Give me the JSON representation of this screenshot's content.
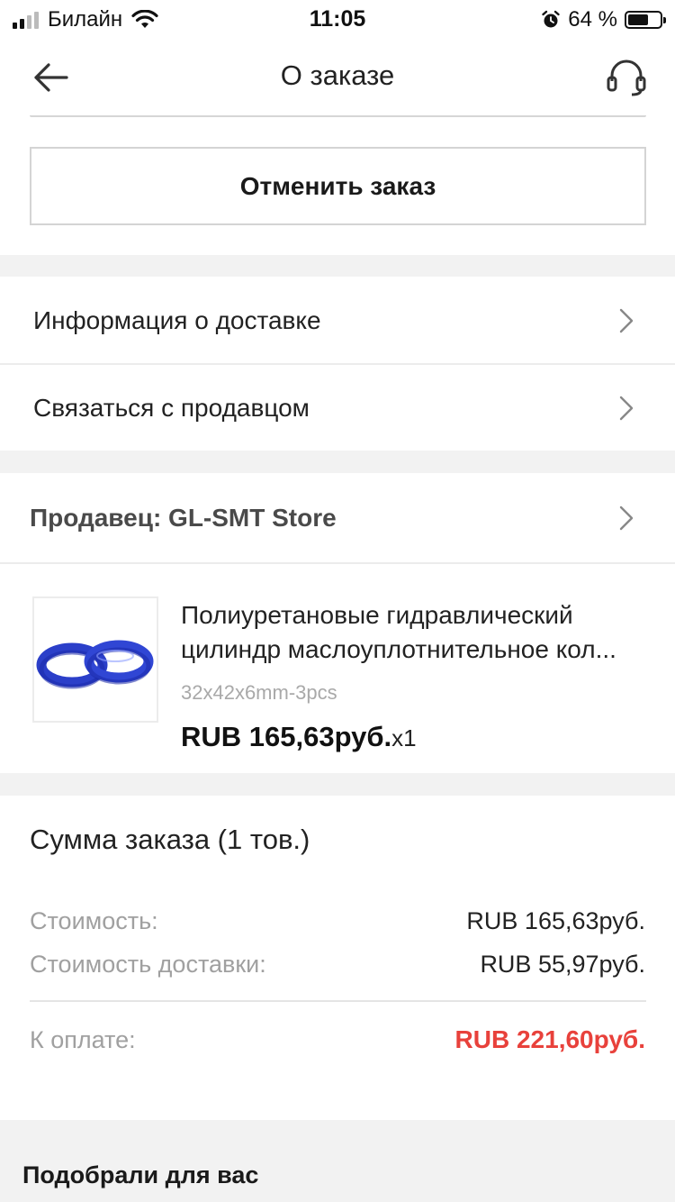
{
  "status_bar": {
    "carrier": "Билайн",
    "time": "11:05",
    "battery_percent": "64 %",
    "battery_level": 0.64
  },
  "nav": {
    "title": "О заказе",
    "back_icon": "arrow-left-icon",
    "support_icon": "headset-icon"
  },
  "cancel_button": {
    "label": "Отменить заказ"
  },
  "menu": {
    "delivery_info": "Информация о доставке",
    "contact_seller": "Связаться с продавцом"
  },
  "seller": {
    "label": "Продавец: GL-SMT Store"
  },
  "product": {
    "title_line1": "Полиуретановые гидравлический",
    "title_line2": "цилиндр маслоуплотнительное кол...",
    "variant": "32x42x6mm-3pcs",
    "price": "RUB 165,63руб.",
    "quantity": "x1",
    "image_icon": "blue-seal-rings-image"
  },
  "summary": {
    "title": "Сумма заказа (1 тов.)",
    "cost_label": "Стоимость:",
    "cost_value": "RUB 165,63руб.",
    "shipping_label": "Стоимость доставки:",
    "shipping_value": "RUB 55,97руб.",
    "total_label": "К оплате:",
    "total_value": "RUB 221,60руб.",
    "total_color": "#e8413b"
  },
  "recommendations": {
    "title": "Подобрали для вас"
  }
}
